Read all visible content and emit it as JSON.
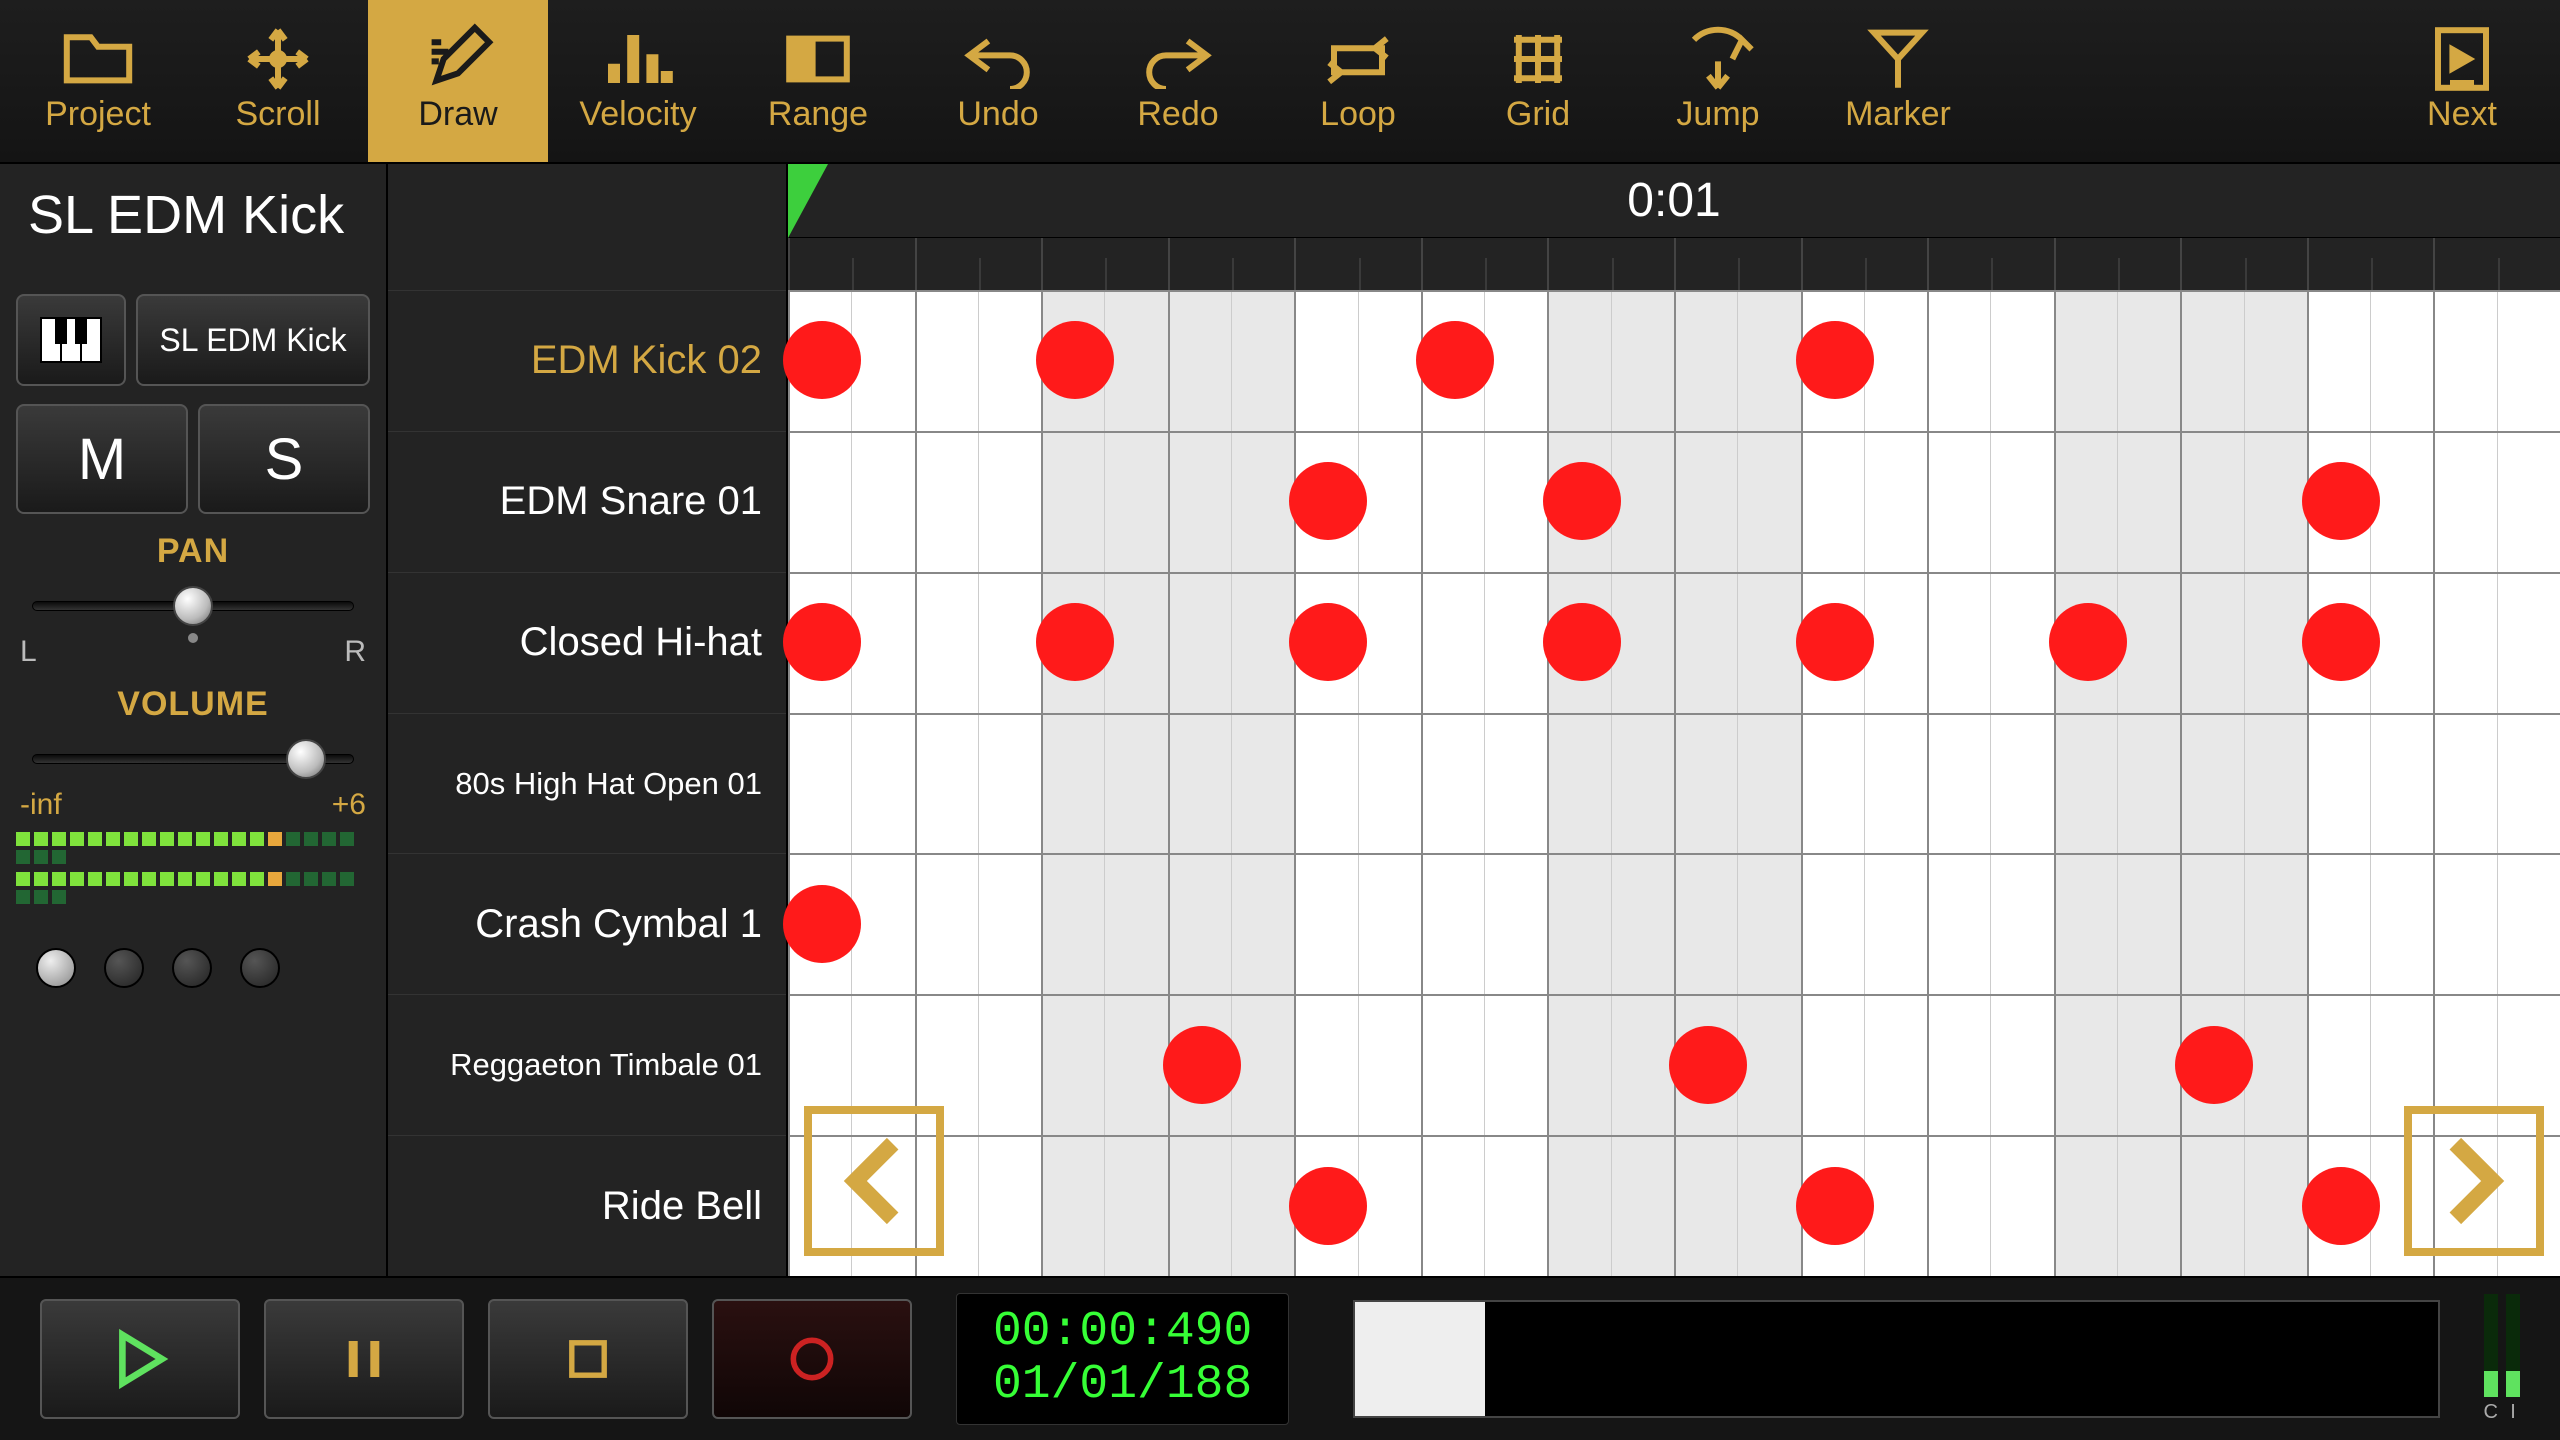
{
  "toolbar": {
    "project": "Project",
    "scroll": "Scroll",
    "draw": "Draw",
    "velocity": "Velocity",
    "range": "Range",
    "undo": "Undo",
    "redo": "Redo",
    "loop": "Loop",
    "grid": "Grid",
    "jump": "Jump",
    "marker": "Marker",
    "next": "Next"
  },
  "active_tool": "draw",
  "track": {
    "title": "SL EDM Kick",
    "instrument": "SL EDM Kick",
    "mute": "M",
    "solo": "S",
    "pan_label": "PAN",
    "pan_left": "L",
    "pan_right": "R",
    "pan_value_pct": 50,
    "volume_label": "VOLUME",
    "volume_min": "-inf",
    "volume_max": "+6",
    "volume_value_pct": 82,
    "page_dot_active": 0,
    "page_dot_count": 4
  },
  "timebar": "0:01",
  "rows": [
    {
      "name": "EDM Kick 02",
      "selected": true,
      "small": false
    },
    {
      "name": "EDM Snare 01",
      "selected": false,
      "small": false
    },
    {
      "name": "Closed Hi-hat",
      "selected": false,
      "small": false
    },
    {
      "name": "80s High Hat Open 01",
      "selected": false,
      "small": true
    },
    {
      "name": "Crash Cymbal 1",
      "selected": false,
      "small": false
    },
    {
      "name": "Reggaeton Timbale 01",
      "selected": false,
      "small": true
    },
    {
      "name": "Ride Bell",
      "selected": false,
      "small": false
    }
  ],
  "grid": {
    "cols": 14,
    "halves": 2,
    "alt_period": 2,
    "notes": [
      {
        "row": 0,
        "col": 0,
        "half": 0
      },
      {
        "row": 0,
        "col": 2,
        "half": 0
      },
      {
        "row": 0,
        "col": 5,
        "half": 0
      },
      {
        "row": 0,
        "col": 8,
        "half": 0
      },
      {
        "row": 1,
        "col": 4,
        "half": 0
      },
      {
        "row": 1,
        "col": 6,
        "half": 0
      },
      {
        "row": 1,
        "col": 12,
        "half": 0
      },
      {
        "row": 2,
        "col": 0,
        "half": 0
      },
      {
        "row": 2,
        "col": 2,
        "half": 0
      },
      {
        "row": 2,
        "col": 4,
        "half": 0
      },
      {
        "row": 2,
        "col": 6,
        "half": 0
      },
      {
        "row": 2,
        "col": 8,
        "half": 0
      },
      {
        "row": 2,
        "col": 10,
        "half": 0
      },
      {
        "row": 2,
        "col": 12,
        "half": 0
      },
      {
        "row": 4,
        "col": 0,
        "half": 0
      },
      {
        "row": 5,
        "col": 3,
        "half": 0
      },
      {
        "row": 5,
        "col": 7,
        "half": 0
      },
      {
        "row": 5,
        "col": 11,
        "half": 0
      },
      {
        "row": 6,
        "col": 4,
        "half": 0
      },
      {
        "row": 6,
        "col": 8,
        "half": 0
      },
      {
        "row": 6,
        "col": 12,
        "half": 0
      }
    ]
  },
  "transport": {
    "time": "00:00:490",
    "position": "01/01/188",
    "meter_labels": [
      "C",
      "I"
    ]
  }
}
